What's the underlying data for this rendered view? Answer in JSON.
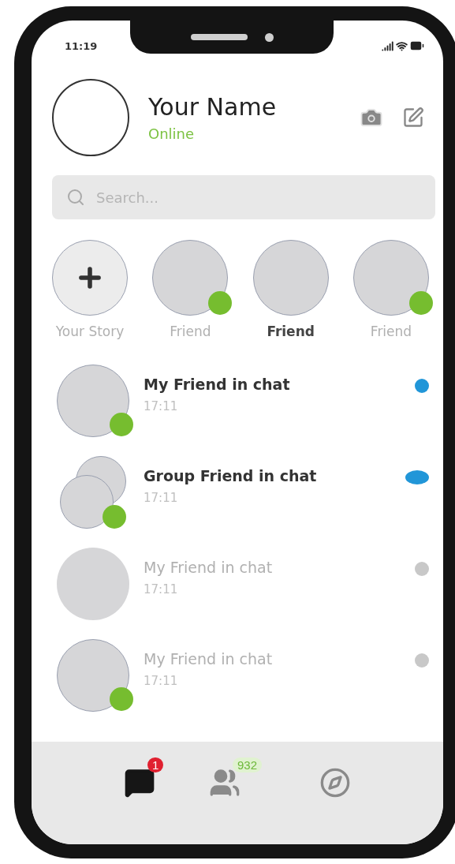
{
  "status_bar": {
    "time": "11:19"
  },
  "profile": {
    "name": "Your Name",
    "status": "Online"
  },
  "search": {
    "placeholder": "Search..."
  },
  "stories": [
    {
      "kind": "add",
      "label": "Your Story",
      "selected": false
    },
    {
      "kind": "friend",
      "label": "Friend",
      "selected": false,
      "online": true
    },
    {
      "kind": "friend",
      "label": "Friend",
      "selected": true,
      "online": false
    },
    {
      "kind": "friend",
      "label": "Friend",
      "selected": false,
      "online": true
    }
  ],
  "chats": [
    {
      "kind": "single",
      "name": "My Friend in chat",
      "time": "17:11",
      "unread": true,
      "online": true,
      "color": "#2196d8"
    },
    {
      "kind": "group",
      "name": "Group Friend in chat",
      "time": "17:11",
      "unread": true,
      "online": true,
      "color": "#2196d8"
    },
    {
      "kind": "single",
      "name": "My Friend in chat",
      "time": "17:11",
      "unread": false,
      "online": false,
      "color": "#c8c8c8"
    },
    {
      "kind": "single",
      "name": "My Friend in chat",
      "time": "17:11",
      "unread": false,
      "online": true,
      "color": "#c8c8c8"
    }
  ],
  "tab_bar": [
    {
      "kind": "chats",
      "badge": "1",
      "selected": true
    },
    {
      "kind": "people",
      "badge": "932",
      "selected": false
    },
    {
      "kind": "discover",
      "selected": false
    }
  ]
}
